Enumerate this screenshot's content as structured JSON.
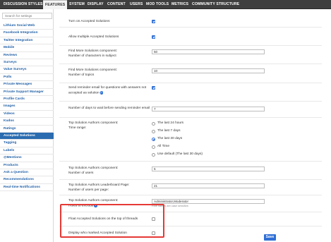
{
  "tabs": [
    "DISCUSSION STYLES",
    "FEATURES",
    "SYSTEM",
    "DISPLAY",
    "CONTENT",
    "USERS",
    "MOD TOOLS",
    "METRICS",
    "COMMUNITY STRUCTURE"
  ],
  "active_tab": "FEATURES",
  "search": {
    "placeholder": "Search for settings"
  },
  "sidebar": {
    "active": "Accepted Solutions",
    "items": [
      "Lithium Social Web",
      "Facebook Integration",
      "Twitter Integration",
      "Mobile",
      "Reviews",
      "Surveys",
      "Value Surveys",
      "Polls",
      "Private Messages",
      "Private Support Manager",
      "Profile Cards",
      "Images",
      "Videos",
      "Kudos",
      "Ratings",
      "Accepted Solutions",
      "Tagging",
      "Labels",
      "@Mentions",
      "Products",
      "Ask a Question",
      "Recommendations",
      "Real-time Notifications"
    ]
  },
  "settings": {
    "turn_on": {
      "label": "Turn on Accepted Solutions",
      "checked": true
    },
    "allow_multiple": {
      "label": "Allow multiple Accepted Solutions",
      "checked": true
    },
    "find_more_chars": {
      "label1": "Find More Solutions component:",
      "label2": "Number of characters in subject",
      "value": "50"
    },
    "find_more_topics": {
      "label1": "Find More Solutions component:",
      "label2": "Number of topics",
      "value": "10"
    },
    "send_reminder": {
      "label1": "Send reminder email for questions with answers not",
      "label2": "accepted as solution",
      "info_icon": "info-icon",
      "checked": true
    },
    "days_to_wait": {
      "label": "Number of days to wait before sending reminder email",
      "value": "7"
    },
    "time_range": {
      "label1": "Top Solution Authors component:",
      "label2": "Time range:",
      "options": [
        "The last 24 hours",
        "The last 7 days",
        "The last 30 days",
        "All Time",
        "Use default (The last 30 days)"
      ],
      "selected": "The last 30 days"
    },
    "num_users": {
      "label1": "Top Solution Authors component:",
      "label2": "Number of users",
      "value": "5"
    },
    "leaderboard_users": {
      "label1": "Top Solution Authors Leaderboard Page:",
      "label2": "Number of users per page:",
      "value": "21"
    },
    "roles_exclude": {
      "label1": "Top Solution Authors component:",
      "label2": "Roles to exclude",
      "value": "Administrator,Moderator",
      "hint": "Role names are case sensitive."
    },
    "float_top": {
      "label": "Float Accepted Solutions on the top of threads",
      "checked": false
    },
    "display_marker": {
      "label": "Display who marked Accepted Solution",
      "checked": false
    }
  },
  "save_label": "Save",
  "colors": {
    "accent": "#2f6fd6",
    "nav_bg": "#3f3f3f",
    "sidebar_active": "#2b6cb0",
    "highlight": "#e53935"
  }
}
